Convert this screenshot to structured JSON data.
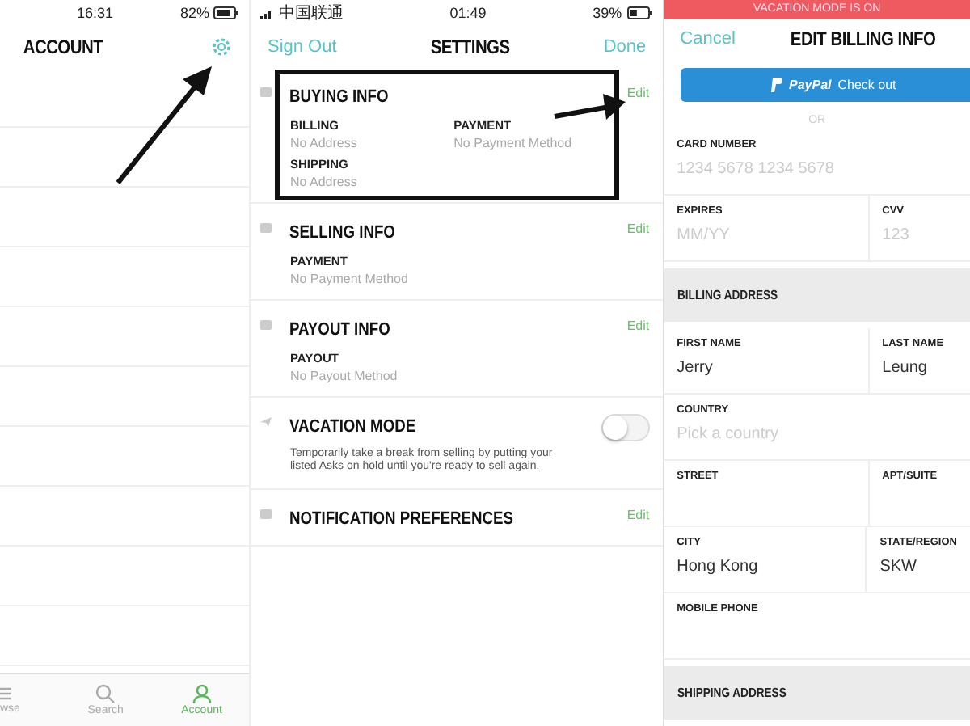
{
  "account_screen": {
    "status_bar": {
      "time": "16:31",
      "battery": "82%"
    },
    "title": "ACCOUNT",
    "tab_bar": [
      {
        "label": "wse",
        "selected": false
      },
      {
        "label": "Search",
        "selected": false
      },
      {
        "label": "Account",
        "selected": true
      }
    ]
  },
  "settings_screen": {
    "status_bar": {
      "carrier": "中国联通",
      "time": "01:49",
      "battery": "39%"
    },
    "left_action": "Sign Out",
    "title": "SETTINGS",
    "right_action": "Done",
    "sections": [
      {
        "kind": "fields",
        "title": "BUYING INFO",
        "action": "Edit",
        "highlighted": true,
        "fields": [
          {
            "label": "BILLING",
            "value": "No Address"
          },
          {
            "label": "PAYMENT",
            "value": "No Payment Method"
          },
          {
            "label": "SHIPPING",
            "value": "No Address"
          }
        ]
      },
      {
        "kind": "fields",
        "title": "SELLING INFO",
        "action": "Edit",
        "highlighted": false,
        "fields": [
          {
            "label": "PAYMENT",
            "value": "No Payment Method"
          }
        ]
      },
      {
        "kind": "fields",
        "title": "PAYOUT INFO",
        "action": "Edit",
        "highlighted": false,
        "fields": [
          {
            "label": "PAYOUT",
            "value": "No Payout Method"
          }
        ]
      },
      {
        "kind": "toggle",
        "title": "VACATION MODE",
        "description": "Temporarily take a break from selling by putting your listed Asks on hold until you're ready to sell again.",
        "on": false
      },
      {
        "kind": "fields",
        "title": "NOTIFICATION PREFERENCES",
        "action": "Edit",
        "highlighted": false
      }
    ]
  },
  "billing_screen": {
    "banner": "VACATION MODE IS ON",
    "left_action": "Cancel",
    "title": "EDIT BILLING INFO",
    "paypal_button": {
      "brand": "PayPal",
      "label": "Check out"
    },
    "separator": "OR",
    "rows": [
      {
        "kind": "fields",
        "fields": [
          {
            "label": "CARD NUMBER",
            "placeholder": "1234 5678 1234 5678"
          }
        ]
      },
      {
        "kind": "fields",
        "fields": [
          {
            "label": "EXPIRES",
            "placeholder": "MM/YY"
          },
          {
            "label": "CVV",
            "placeholder": "123"
          }
        ]
      },
      {
        "kind": "heading",
        "title": "BILLING ADDRESS"
      },
      {
        "kind": "fields",
        "fields": [
          {
            "label": "FIRST NAME",
            "value": "Jerry"
          },
          {
            "label": "LAST NAME",
            "value": "Leung"
          }
        ]
      },
      {
        "kind": "fields",
        "fields": [
          {
            "label": "COUNTRY",
            "placeholder": "Pick a country"
          }
        ]
      },
      {
        "kind": "fields",
        "fields": [
          {
            "label": "STREET"
          },
          {
            "label": "APT/SUITE"
          }
        ]
      },
      {
        "kind": "fields",
        "fields": [
          {
            "label": "CITY",
            "value": "Hong Kong"
          },
          {
            "label": "STATE/REGION",
            "value": "SKW"
          }
        ]
      },
      {
        "kind": "fields",
        "fields": [
          {
            "label": "MOBILE PHONE"
          }
        ]
      },
      {
        "kind": "heading",
        "title": "SHIPPING ADDRESS"
      }
    ]
  }
}
